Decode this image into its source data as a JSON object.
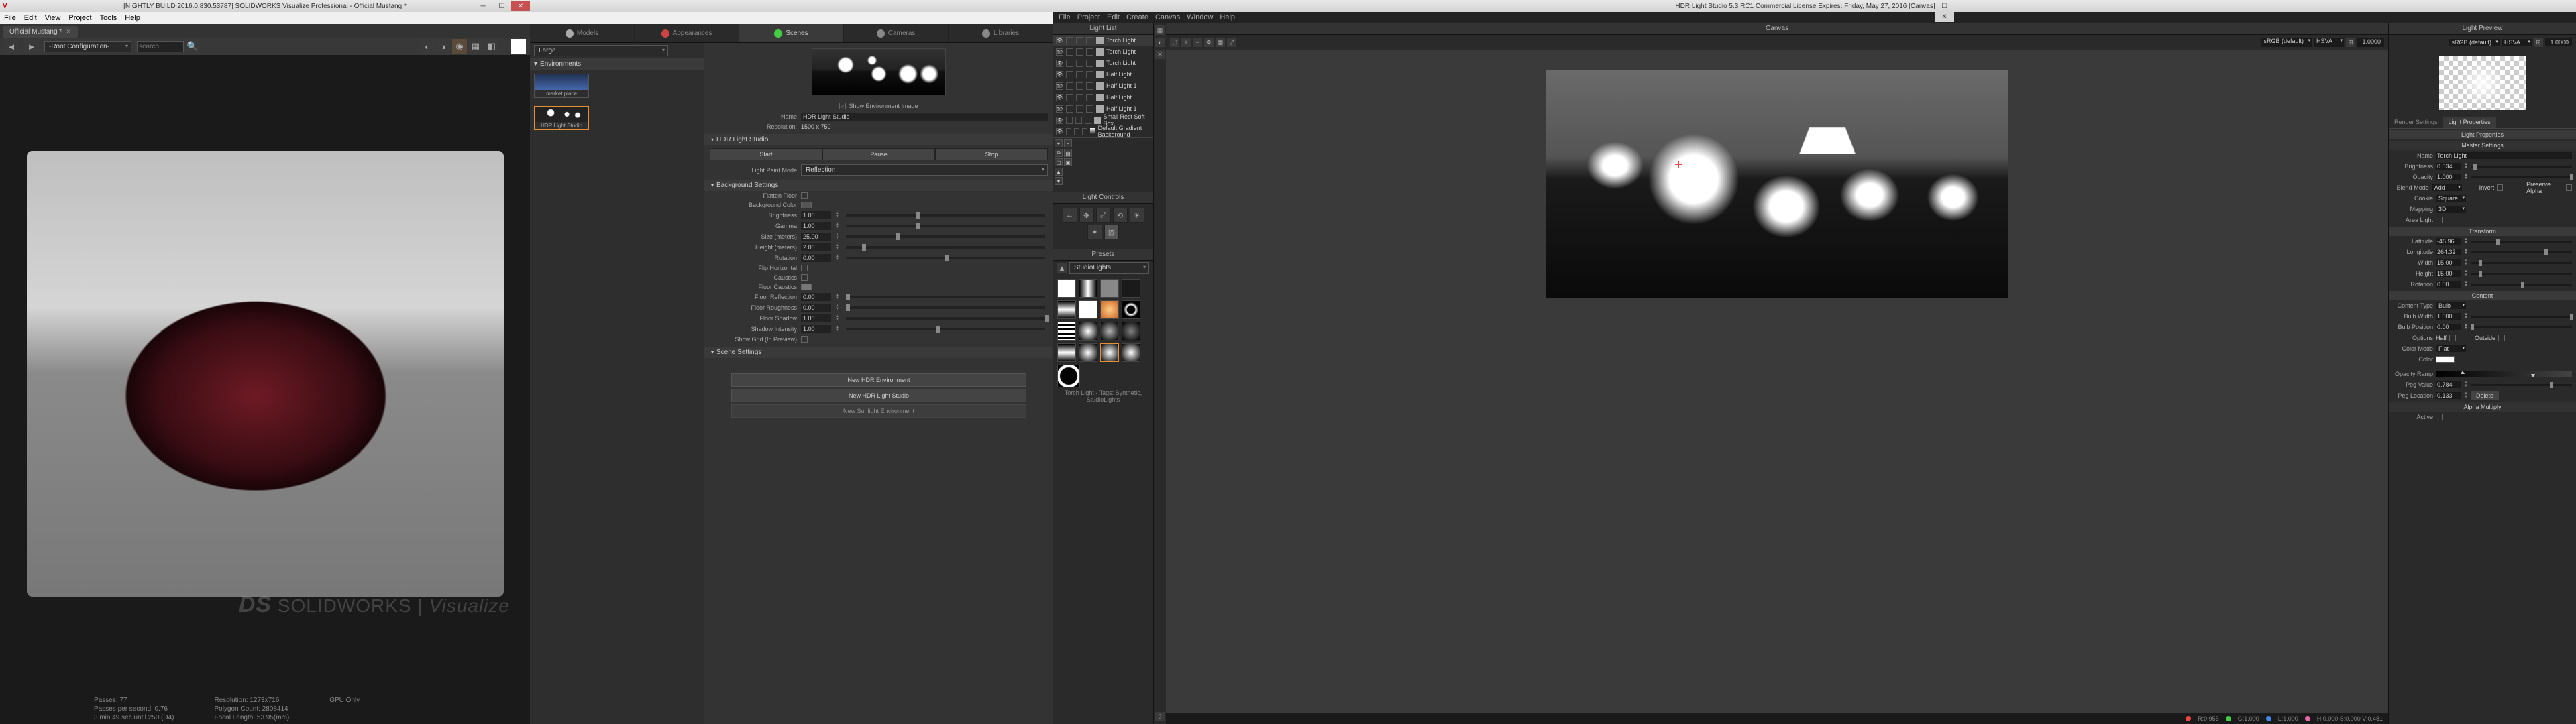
{
  "sw": {
    "title": "[NIGHTLY BUILD 2016.0.830.53787] SOLIDWORKS Visualize Professional - Official Mustang *",
    "menu": [
      "File",
      "Edit",
      "View",
      "Project",
      "Tools",
      "Help"
    ],
    "doctab": "Official Mustang *",
    "config": "-Root Configuration-",
    "search_ph": "search...",
    "watermark_brand": "SOLIDWORKS",
    "watermark_sub": "Visualize",
    "status": {
      "passes": "Passes: 77",
      "pps": "Passes per second: 0.76",
      "eta": "3 min 49 sec until 250 (D4)",
      "res": "Resolution: 1273x716",
      "poly": "Polygon Count: 2808414",
      "focal": "Focal Length: 53.95(mm)",
      "gpu": "GPU Only"
    },
    "tabs": [
      "Models",
      "Appearances",
      "Scenes",
      "Cameras",
      "Libraries"
    ],
    "size": "Large",
    "env_hdr": "Environments",
    "envs": [
      "market place",
      "HDR Light Studio"
    ],
    "show_env": "Show Environment Image",
    "name_lbl": "Name",
    "name_val": "HDR Light Studio",
    "res_lbl": "Resolution:",
    "res_val": "1500 x 750",
    "sec_hls": "HDR Light Studio",
    "btn_start": "Start",
    "btn_pause": "Pause",
    "btn_stop": "Stop",
    "lpm_lbl": "Light Paint Mode",
    "lpm_val": "Reflection",
    "sec_bg": "Background Settings",
    "flatten": "Flatten Floor",
    "bgcolor": "Background Color",
    "brightness": "Brightness",
    "brightness_v": "1.00",
    "gamma": "Gamma",
    "gamma_v": "1.00",
    "size_m": "Size (meters)",
    "size_m_v": "25.00",
    "height_m": "Height (meters)",
    "height_m_v": "2.00",
    "rotation": "Rotation",
    "rotation_v": "0.00",
    "fliph": "Flip Horizontal",
    "caustics": "Caustics",
    "fcaustics": "Floor Caustics",
    "freflect": "Floor Reflection",
    "freflect_v": "0.00",
    "frough": "Floor Roughness",
    "frough_v": "0.00",
    "fshadow": "Floor Shadow",
    "fshadow_v": "1.00",
    "shint": "Shadow Intensity",
    "shint_v": "1.00",
    "showgrid": "Show Grid (In Preview)",
    "sec_scene": "Scene Settings",
    "btn_newenv": "New HDR Environment",
    "btn_newhls": "New HDR Light Studio",
    "btn_newsun": "New Sunlight Environment"
  },
  "hdr": {
    "title": "HDR Light Studio 5.3 RC1 Commercial License Expires: Friday, May 27, 2016  [Canvas]",
    "menu": [
      "File",
      "Project",
      "Edit",
      "Create",
      "Canvas",
      "Window",
      "Help"
    ],
    "panel_lightlist": "Light List",
    "lights": [
      "Torch Light",
      "Torch Light",
      "Torch Light",
      "Half Light",
      "Half Light 1",
      "Half Light",
      "Half Light 1",
      "Small Rect Soft Box",
      "Default Gradient Background"
    ],
    "panel_lc": "Light Controls",
    "panel_presets": "Presets",
    "preset_cat": "StudioLights",
    "preset_info": "Torch Light - Tags: Synthetic, StudioLights",
    "panel_canvas": "Canvas",
    "cs1": "sRGB (default)",
    "cs2": "HSVA",
    "one": "1.0000",
    "status_r": "R:0.955",
    "status_g": "G:1.000",
    "status_l": "L:1.000",
    "status_h": "H:0.000 S:0.000 V:0.481",
    "panel_preview": "Light Preview",
    "tab_rs": "Render Settings",
    "tab_lp": "Light Properties",
    "sec_lp": "Light Properties",
    "sec_master": "Master Settings",
    "name": "Name",
    "name_v": "Torch Light",
    "bright": "Brightness",
    "bright_v": "0.034",
    "opac": "Opacity",
    "opac_v": "1.000",
    "blend": "Blend Mode",
    "blend_v": "Add",
    "invert": "Invert",
    "palpha": "Preserve Alpha",
    "cookie": "Cookie",
    "cookie_v": "Square",
    "mapping": "Mapping",
    "mapping_v": "3D",
    "arealight": "Area Light",
    "sec_tf": "Transform",
    "lat": "Latitude",
    "lat_v": "-45.96",
    "lon": "Longitude",
    "lon_v": "264.32",
    "width": "Width",
    "width_v": "15.00",
    "height": "Height",
    "height_v": "15.00",
    "rot": "Rotation",
    "rot_v": "0.00",
    "sec_content": "Content",
    "ctype": "Content Type",
    "ctype_v": "Bulb",
    "bwidth": "Bulb Width",
    "bwidth_v": "1.000",
    "bpos": "Bulb Position",
    "bpos_v": "0.00",
    "options": "Options",
    "half": "Half",
    "outside": "Outside",
    "cmode": "Color Mode",
    "cmode_v": "Flat",
    "color": "Color",
    "oramp": "Opacity Ramp",
    "pegval": "Peg Value",
    "pegval_v": "0.784",
    "pegloc": "Peg Location",
    "pegloc_v": "0.133",
    "delete": "Delete",
    "amul": "Alpha Multiply",
    "active": "Active"
  }
}
